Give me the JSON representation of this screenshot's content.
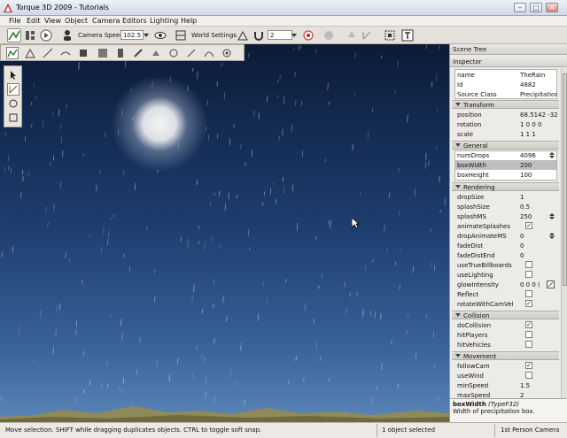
{
  "window": {
    "title": "Torque 3D 2009 - Tutorials",
    "minimize": "–",
    "maximize": "□",
    "close": "×"
  },
  "menu": [
    "File",
    "Edit",
    "View",
    "Object",
    "Camera",
    "Editors",
    "Lighting",
    "Help"
  ],
  "toolbar": {
    "camera_speed_label": "Camera Speed",
    "camera_speed_value": "102.5",
    "world_settings_label": "World Settings",
    "snap_value": "2"
  },
  "rpanel": {
    "scene_tree": "Scene Tree",
    "inspector": "Inspector"
  },
  "inspector": {
    "top": [
      {
        "label": "name",
        "value": "TheRain"
      },
      {
        "label": "Id",
        "value": "4882"
      },
      {
        "label": "Source Class",
        "value": "Precipitation"
      }
    ],
    "transform": {
      "title": "Transform",
      "rows": [
        {
          "label": "position",
          "value": "68.5142 -32"
        },
        {
          "label": "rotation",
          "value": "1 0 0 0"
        },
        {
          "label": "scale",
          "value": "1 1 1"
        }
      ]
    },
    "general": {
      "title": "General",
      "rows": [
        {
          "label": "numDrops",
          "value": "4096"
        },
        {
          "label": "boxWidth",
          "value": "200"
        },
        {
          "label": "boxHeight",
          "value": "100"
        }
      ]
    },
    "rendering": {
      "title": "Rendering",
      "rows": [
        {
          "label": "dropSize",
          "value": "1"
        },
        {
          "label": "splashSize",
          "value": "0.5"
        },
        {
          "label": "splashMS",
          "value": "250"
        },
        {
          "label": "animateSplashes",
          "value": "✓"
        },
        {
          "label": "dropAnimateMS",
          "value": "0"
        },
        {
          "label": "fadeDist",
          "value": "0"
        },
        {
          "label": "fadeDistEnd",
          "value": "0"
        },
        {
          "label": "useTrueBillboards",
          "value": ""
        },
        {
          "label": "useLighting",
          "value": ""
        },
        {
          "label": "glowIntensity",
          "value": "0 0 0 ("
        },
        {
          "label": "Reflect",
          "value": ""
        },
        {
          "label": "rotateWithCamVel",
          "value": "✓"
        }
      ]
    },
    "collision": {
      "title": "Collision",
      "rows": [
        {
          "label": "doCollision",
          "value": "✓"
        },
        {
          "label": "hitPlayers",
          "value": ""
        },
        {
          "label": "hitVehicles",
          "value": ""
        }
      ]
    },
    "movement": {
      "title": "Movement",
      "rows": [
        {
          "label": "followCam",
          "value": "✓"
        },
        {
          "label": "useWind",
          "value": ""
        },
        {
          "label": "minSpeed",
          "value": "1.5"
        },
        {
          "label": "maxSpeed",
          "value": "2"
        }
      ]
    }
  },
  "help": {
    "field": "boxWidth",
    "type": "(TypeF32)",
    "description": "Width of precipitation box."
  },
  "status": {
    "hint": "Move selection.  SHIFT while dragging duplicates objects.  CTRL to toggle soft snap.",
    "selection": "1 object selected",
    "camera": "1st Person Camera"
  },
  "viewport": {
    "sky_top": "#0c1a36",
    "sky_bottom": "#5b86b8"
  }
}
